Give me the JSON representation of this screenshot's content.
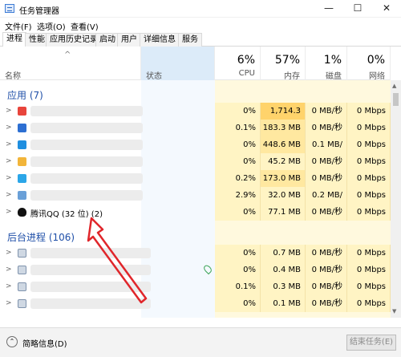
{
  "window": {
    "title": "任务管理器",
    "controls": [
      "—",
      "☐",
      "✕"
    ]
  },
  "menu": [
    "文件(F)",
    "选项(O)",
    "查看(V)"
  ],
  "tabs": [
    "进程",
    "性能",
    "应用历史记录",
    "启动",
    "用户",
    "详细信息",
    "服务"
  ],
  "active_tab": 0,
  "columns": {
    "name": "名称",
    "status": "状态",
    "cpu": {
      "pct": "6%",
      "label": "CPU"
    },
    "mem": {
      "pct": "57%",
      "label": "内存"
    },
    "disk": {
      "pct": "1%",
      "label": "磁盘"
    },
    "net": {
      "pct": "0%",
      "label": "网络"
    }
  },
  "groups": {
    "apps": "应用 (7)",
    "background": "后台进程 (106)"
  },
  "app_rows": [
    {
      "icon": "chrome-icon",
      "cpu": "0%",
      "mem": "1,714.3 ...",
      "disk": "0 MB/秒",
      "net": "0 Mbps",
      "mem_heat": "y3"
    },
    {
      "icon": "dev-icon",
      "cpu": "0.1%",
      "mem": "183.3 MB",
      "disk": "0 MB/秒",
      "net": "0 Mbps",
      "mem_heat": "y2"
    },
    {
      "icon": "browser-icon",
      "cpu": "0%",
      "mem": "448.6 MB",
      "disk": "0.1 MB/秒",
      "net": "0 Mbps",
      "mem_heat": "y2"
    },
    {
      "icon": "folder-icon",
      "cpu": "0%",
      "mem": "45.2 MB",
      "disk": "0 MB/秒",
      "net": "0 Mbps",
      "mem_heat": "y1"
    },
    {
      "icon": "app-icon",
      "cpu": "0.2%",
      "mem": "173.0 MB",
      "disk": "0 MB/秒",
      "net": "0 Mbps",
      "mem_heat": "y2"
    },
    {
      "icon": "monitor-icon",
      "cpu": "2.9%",
      "mem": "32.0 MB",
      "disk": "0.2 MB/秒",
      "net": "0 Mbps",
      "mem_heat": "y1"
    },
    {
      "icon": "qq-penguin-icon",
      "name": "腾讯QQ (32 位) (2)",
      "cpu": "0%",
      "mem": "77.1 MB",
      "disk": "0 MB/秒",
      "net": "0 Mbps",
      "mem_heat": "y1"
    }
  ],
  "bg_rows": [
    {
      "cpu": "0%",
      "mem": "0.7 MB",
      "disk": "0 MB/秒",
      "net": "0 Mbps"
    },
    {
      "cpu": "0%",
      "mem": "0.4 MB",
      "disk": "0 MB/秒",
      "net": "0 Mbps"
    },
    {
      "cpu": "0.1%",
      "mem": "0.3 MB",
      "disk": "0 MB/秒",
      "net": "0 Mbps"
    },
    {
      "cpu": "0%",
      "mem": "0.1 MB",
      "disk": "0 MB/秒",
      "net": "0 Mbps"
    }
  ],
  "bottom": {
    "summary": "简略信息(D)",
    "end_task": "结束任务(E)"
  },
  "colors": {
    "group_title": "#1f4fa8",
    "annotation_arrow": "#e0262b"
  }
}
